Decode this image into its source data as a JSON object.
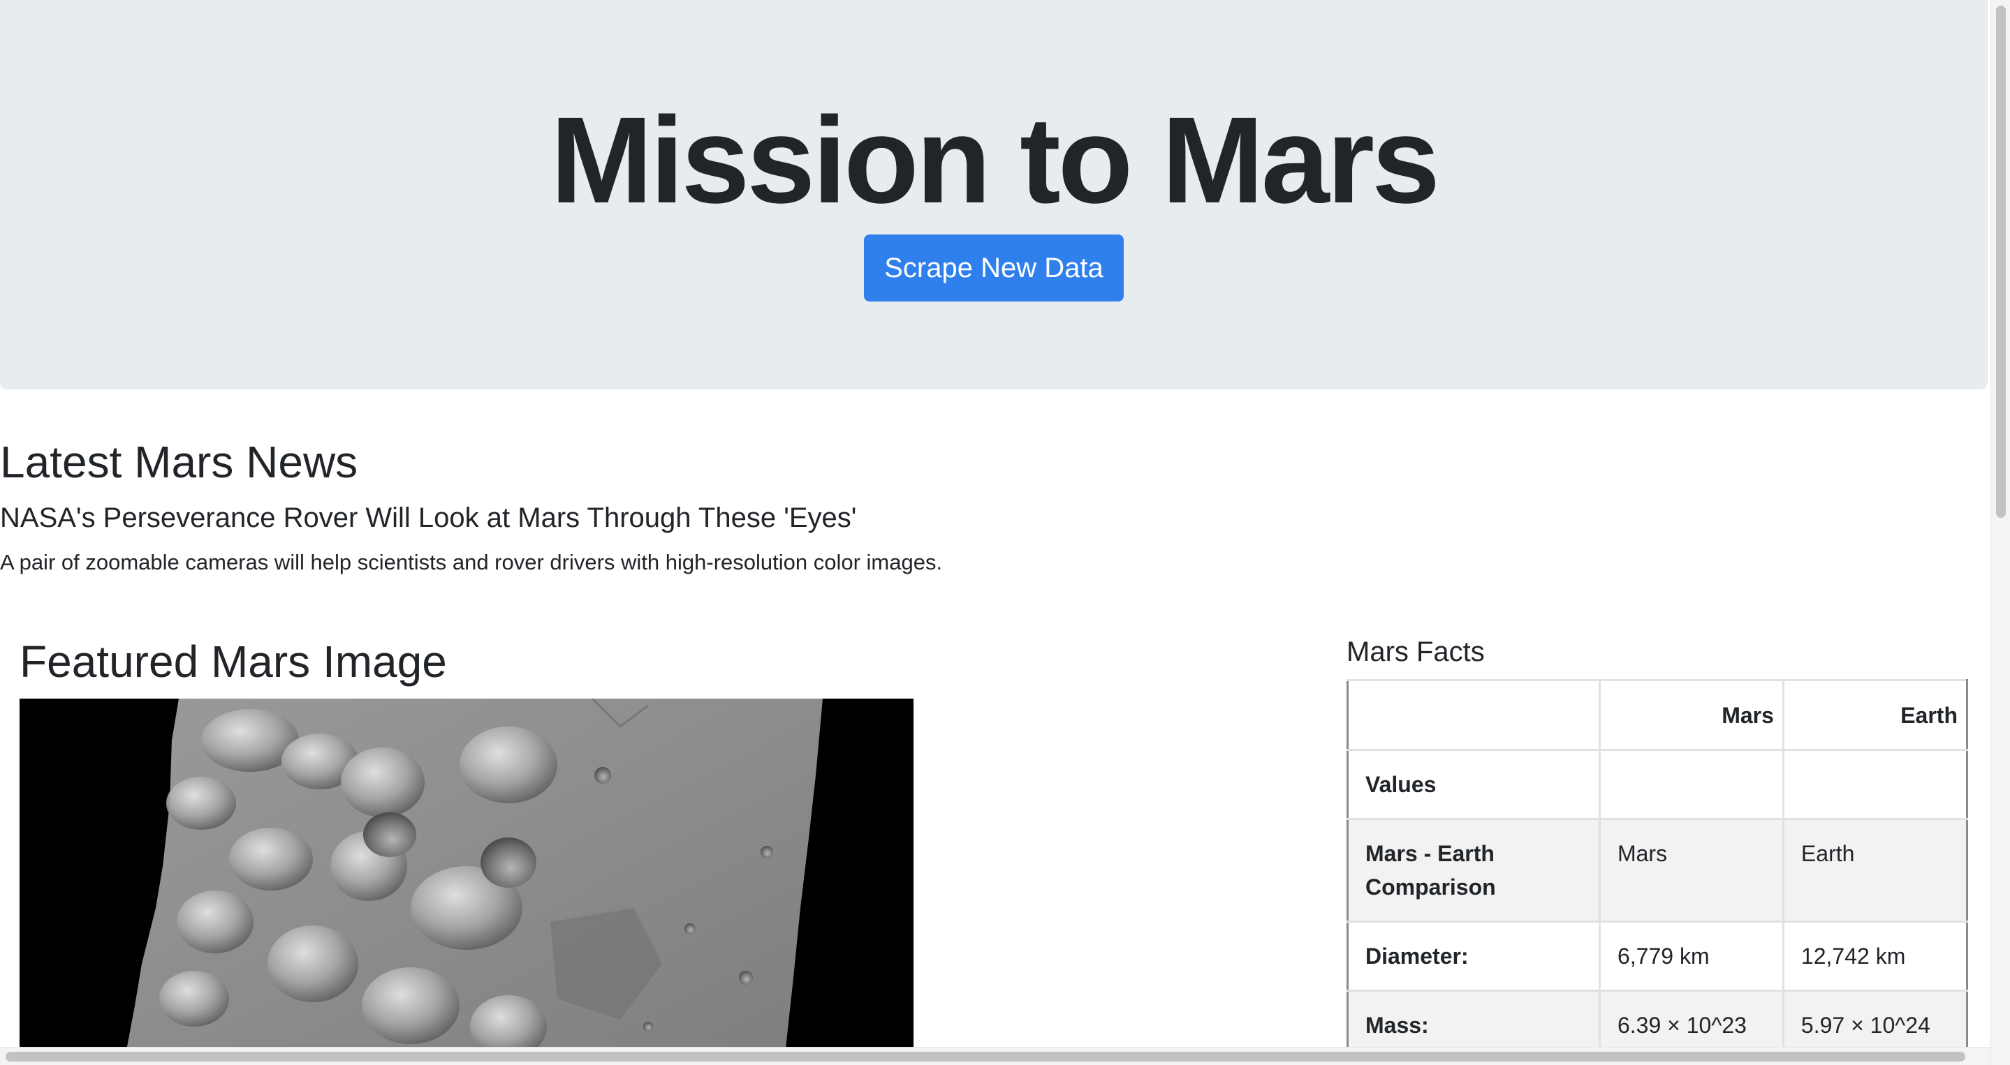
{
  "header": {
    "title": "Mission to Mars",
    "scrape_button_label": "Scrape New Data"
  },
  "news": {
    "heading": "Latest Mars News",
    "title": "NASA's Perseverance Rover Will Look at Mars Through These 'Eyes'",
    "teaser": "A pair of zoomable cameras will help scientists and rover drivers with high-resolution color images."
  },
  "featured": {
    "heading": "Featured Mars Image"
  },
  "facts": {
    "heading": "Mars Facts",
    "columns": [
      "",
      "Mars",
      "Earth"
    ],
    "rows": [
      {
        "label": "Values",
        "mars": "",
        "earth": ""
      },
      {
        "label": "Mars - Earth Comparison",
        "mars": "Mars",
        "earth": "Earth"
      },
      {
        "label": "Diameter:",
        "mars": "6,779 km",
        "earth": "12,742 km"
      },
      {
        "label": "Mass:",
        "mars": "6.39 × 10^23",
        "earth": "5.97 × 10^24"
      }
    ]
  },
  "colors": {
    "jumbotron_bg": "#e9ecef",
    "button_bg": "#2f80ed",
    "text": "#212529",
    "table_stripe": "#f2f2f2"
  }
}
